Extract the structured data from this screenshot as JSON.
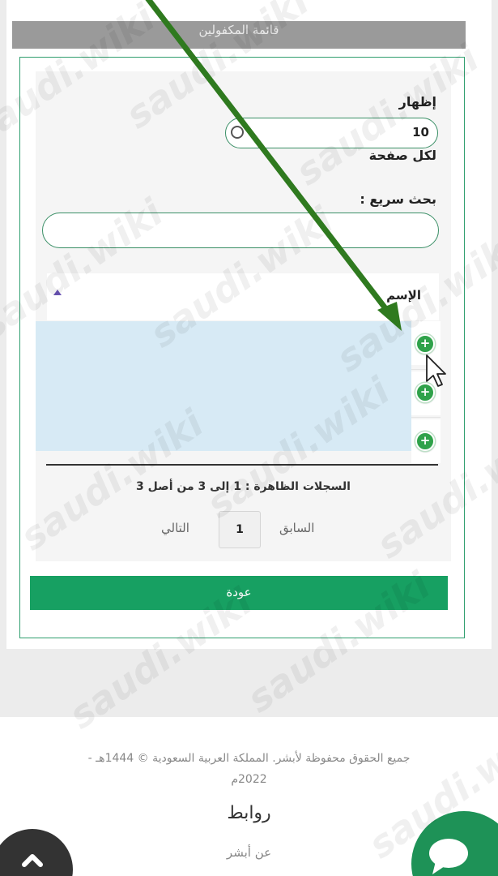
{
  "page": {
    "title": "قائمة المكفولين"
  },
  "pagesize": {
    "show_label": "إظهار",
    "value": "10",
    "per_page_label": "لكل صفحة"
  },
  "search": {
    "label": "بحث سريع :",
    "placeholder": ""
  },
  "table": {
    "column_name": "الإسم",
    "rows": 3
  },
  "pagination": {
    "records_info": "السجلات الظاهرة : 1 إلى 3 من أصل 3",
    "previous": "السابق",
    "current_page": "1",
    "next": "التالي"
  },
  "actions": {
    "back": "عودة"
  },
  "footer": {
    "copyright_line1": "جميع الحقوق محفوظة لأبشر. المملكة العربية السعودية © 1444هـ -",
    "copyright_line2": "2022م",
    "links_title": "روابط",
    "link_about": "عن أبشر"
  },
  "watermark": "saudi.wiki",
  "colors": {
    "accent_green": "#17a062",
    "panel_border": "#2f9e6e",
    "arrow_green": "#2f7a1f",
    "row_highlight": "#d7eaf5",
    "title_bar": "#9a9a9a"
  },
  "icons": {
    "sort": "sort-up-icon",
    "expand": "plus-circle-icon",
    "scroll_top": "chevron-up-icon",
    "chat": "chat-bubble-icon",
    "cursor": "mouse-pointer-icon"
  }
}
